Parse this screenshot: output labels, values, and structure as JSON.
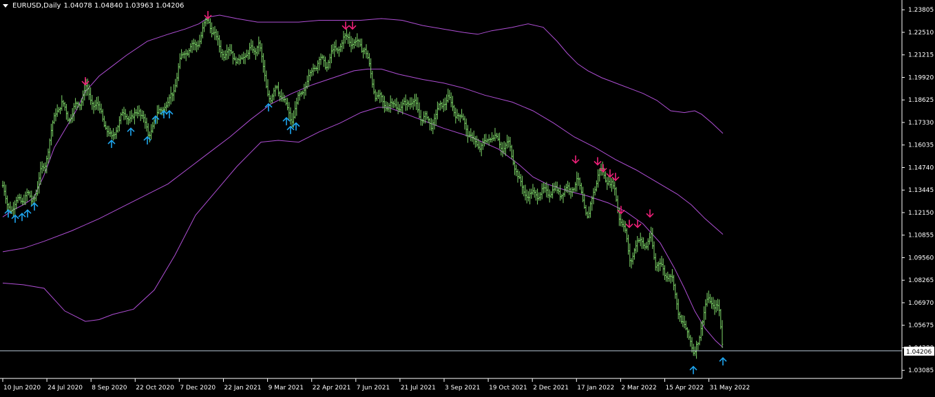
{
  "header": {
    "symbol_timeframe": "EURUSD,Daily",
    "ohlc": "1.04078 1.04840 1.03963 1.04206"
  },
  "colors": {
    "background": "#000000",
    "bars": "#7fd96a",
    "bands": "#b04fd6",
    "up_arrow": "#1ea6f0",
    "down_arrow": "#f0207a",
    "axis": "#ffffff",
    "price_line": "#b8c8d8"
  },
  "chart_data": {
    "type": "bar",
    "title": "EURUSD,Daily",
    "ylim": [
      1.0262,
      1.2421
    ],
    "y_ticks": [
      "1.23805",
      "1.22510",
      "1.21215",
      "1.19920",
      "1.18625",
      "1.17330",
      "1.16035",
      "1.14740",
      "1.13445",
      "1.12150",
      "1.10855",
      "1.09560",
      "1.08265",
      "1.06970",
      "1.05675",
      "1.04380",
      "1.03085"
    ],
    "current_price_label": "1.04206",
    "current_price": 1.04206,
    "x_tick_labels": [
      "10 Jun 2020",
      "24 Jul 2020",
      "8 Sep 2020",
      "22 Oct 2020",
      "7 Dec 2020",
      "22 Jan 2021",
      "9 Mar 2021",
      "22 Apr 2021",
      "7 Jun 2021",
      "21 Jul 2021",
      "3 Sep 2021",
      "19 Oct 2021",
      "2 Dec 2021",
      "17 Jan 2022",
      "2 Mar 2022",
      "15 Apr 2022",
      "31 May 2022"
    ],
    "price_path": [
      [
        0,
        1.137
      ],
      [
        6,
        1.124
      ],
      [
        12,
        1.123
      ],
      [
        20,
        1.126
      ],
      [
        28,
        1.129
      ],
      [
        35,
        1.133
      ],
      [
        42,
        1.129
      ],
      [
        50,
        1.137
      ],
      [
        55,
        1.144
      ],
      [
        62,
        1.15
      ],
      [
        70,
        1.165
      ],
      [
        78,
        1.18
      ],
      [
        86,
        1.184
      ],
      [
        95,
        1.177
      ],
      [
        103,
        1.182
      ],
      [
        112,
        1.185
      ],
      [
        120,
        1.193
      ],
      [
        128,
        1.184
      ],
      [
        136,
        1.183
      ],
      [
        144,
        1.177
      ],
      [
        152,
        1.17
      ],
      [
        158,
        1.164
      ],
      [
        166,
        1.173
      ],
      [
        174,
        1.177
      ],
      [
        182,
        1.176
      ],
      [
        190,
        1.174
      ],
      [
        198,
        1.181
      ],
      [
        205,
        1.176
      ],
      [
        211,
        1.166
      ],
      [
        218,
        1.174
      ],
      [
        225,
        1.178
      ],
      [
        232,
        1.182
      ],
      [
        240,
        1.183
      ],
      [
        248,
        1.19
      ],
      [
        256,
        1.206
      ],
      [
        264,
        1.215
      ],
      [
        272,
        1.218
      ],
      [
        280,
        1.218
      ],
      [
        288,
        1.223
      ],
      [
        298,
        1.232
      ],
      [
        306,
        1.223
      ],
      [
        314,
        1.218
      ],
      [
        322,
        1.213
      ],
      [
        332,
        1.216
      ],
      [
        342,
        1.207
      ],
      [
        350,
        1.211
      ],
      [
        358,
        1.213
      ],
      [
        366,
        1.213
      ],
      [
        372,
        1.221
      ],
      [
        378,
        1.205
      ],
      [
        384,
        1.193
      ],
      [
        390,
        1.188
      ],
      [
        398,
        1.194
      ],
      [
        406,
        1.187
      ],
      [
        414,
        1.178
      ],
      [
        420,
        1.174
      ],
      [
        428,
        1.185
      ],
      [
        436,
        1.193
      ],
      [
        444,
        1.2
      ],
      [
        452,
        1.206
      ],
      [
        460,
        1.209
      ],
      [
        470,
        1.205
      ],
      [
        478,
        1.212
      ],
      [
        486,
        1.216
      ],
      [
        494,
        1.221
      ],
      [
        502,
        1.224
      ],
      [
        510,
        1.219
      ],
      [
        518,
        1.218
      ],
      [
        526,
        1.214
      ],
      [
        534,
        1.201
      ],
      [
        542,
        1.188
      ],
      [
        550,
        1.187
      ],
      [
        560,
        1.184
      ],
      [
        570,
        1.184
      ],
      [
        580,
        1.18
      ],
      [
        590,
        1.185
      ],
      [
        598,
        1.184
      ],
      [
        606,
        1.178
      ],
      [
        614,
        1.177
      ],
      [
        622,
        1.173
      ],
      [
        630,
        1.178
      ],
      [
        638,
        1.183
      ],
      [
        646,
        1.186
      ],
      [
        654,
        1.181
      ],
      [
        662,
        1.178
      ],
      [
        670,
        1.175
      ],
      [
        678,
        1.167
      ],
      [
        686,
        1.161
      ],
      [
        694,
        1.159
      ],
      [
        702,
        1.16
      ],
      [
        710,
        1.166
      ],
      [
        718,
        1.164
      ],
      [
        726,
        1.16
      ],
      [
        734,
        1.162
      ],
      [
        742,
        1.152
      ],
      [
        750,
        1.138
      ],
      [
        758,
        1.132
      ],
      [
        766,
        1.13
      ],
      [
        774,
        1.133
      ],
      [
        782,
        1.134
      ],
      [
        790,
        1.135
      ],
      [
        800,
        1.134
      ],
      [
        810,
        1.132
      ],
      [
        818,
        1.133
      ],
      [
        826,
        1.135
      ],
      [
        834,
        1.141
      ],
      [
        842,
        1.132
      ],
      [
        850,
        1.118
      ],
      [
        858,
        1.133
      ],
      [
        866,
        1.145
      ],
      [
        874,
        1.14
      ],
      [
        880,
        1.14
      ],
      [
        888,
        1.135
      ],
      [
        895,
        1.122
      ],
      [
        903,
        1.113
      ],
      [
        911,
        1.095
      ],
      [
        919,
        1.1
      ],
      [
        927,
        1.106
      ],
      [
        935,
        1.1
      ],
      [
        942,
        1.108
      ],
      [
        948,
        1.093
      ],
      [
        956,
        1.092
      ],
      [
        962,
        1.088
      ],
      [
        968,
        1.086
      ],
      [
        974,
        1.08
      ],
      [
        980,
        1.067
      ],
      [
        986,
        1.056
      ],
      [
        992,
        1.053
      ],
      [
        998,
        1.051
      ],
      [
        1004,
        1.039
      ],
      [
        1010,
        1.048
      ],
      [
        1016,
        1.062
      ],
      [
        1022,
        1.07
      ],
      [
        1028,
        1.071
      ],
      [
        1034,
        1.068
      ],
      [
        1040,
        1.064
      ],
      [
        1046,
        1.042
      ]
    ],
    "series": [
      {
        "name": "",
        "kind": "upper_band",
        "points": [
          [
            0,
            1.119
          ],
          [
            15,
            1.123
          ],
          [
            30,
            1.126
          ],
          [
            45,
            1.13
          ],
          [
            60,
            1.143
          ],
          [
            75,
            1.159
          ],
          [
            90,
            1.169
          ],
          [
            105,
            1.179
          ],
          [
            120,
            1.191
          ],
          [
            140,
            1.2
          ],
          [
            160,
            1.206
          ],
          [
            180,
            1.212
          ],
          [
            210,
            1.22
          ],
          [
            240,
            1.224
          ],
          [
            265,
            1.227
          ],
          [
            285,
            1.23
          ],
          [
            300,
            1.234
          ],
          [
            315,
            1.235
          ],
          [
            340,
            1.233
          ],
          [
            370,
            1.231
          ],
          [
            400,
            1.231
          ],
          [
            430,
            1.231
          ],
          [
            460,
            1.232
          ],
          [
            490,
            1.232
          ],
          [
            520,
            1.232
          ],
          [
            550,
            1.233
          ],
          [
            580,
            1.232
          ],
          [
            610,
            1.229
          ],
          [
            640,
            1.227
          ],
          [
            670,
            1.225
          ],
          [
            690,
            1.224
          ],
          [
            710,
            1.226
          ],
          [
            740,
            1.228
          ],
          [
            763,
            1.23
          ],
          [
            785,
            1.228
          ],
          [
            805,
            1.22
          ],
          [
            820,
            1.213
          ],
          [
            835,
            1.207
          ],
          [
            850,
            1.203
          ],
          [
            870,
            1.199
          ],
          [
            890,
            1.196
          ],
          [
            910,
            1.193
          ],
          [
            930,
            1.19
          ],
          [
            950,
            1.186
          ],
          [
            970,
            1.18
          ],
          [
            990,
            1.179
          ],
          [
            1005,
            1.18
          ],
          [
            1015,
            1.178
          ],
          [
            1030,
            1.173
          ],
          [
            1046,
            1.167
          ]
        ]
      },
      {
        "name": "",
        "kind": "middle_band",
        "points": [
          [
            0,
            1.099
          ],
          [
            30,
            1.101
          ],
          [
            60,
            1.105
          ],
          [
            100,
            1.111
          ],
          [
            140,
            1.118
          ],
          [
            180,
            1.126
          ],
          [
            210,
            1.132
          ],
          [
            240,
            1.138
          ],
          [
            270,
            1.147
          ],
          [
            300,
            1.156
          ],
          [
            330,
            1.165
          ],
          [
            360,
            1.175
          ],
          [
            390,
            1.184
          ],
          [
            420,
            1.19
          ],
          [
            450,
            1.195
          ],
          [
            480,
            1.199
          ],
          [
            510,
            1.203
          ],
          [
            530,
            1.204
          ],
          [
            550,
            1.204
          ],
          [
            575,
            1.201
          ],
          [
            610,
            1.198
          ],
          [
            640,
            1.196
          ],
          [
            670,
            1.193
          ],
          [
            700,
            1.189
          ],
          [
            740,
            1.185
          ],
          [
            770,
            1.18
          ],
          [
            800,
            1.173
          ],
          [
            830,
            1.165
          ],
          [
            860,
            1.159
          ],
          [
            890,
            1.152
          ],
          [
            920,
            1.146
          ],
          [
            950,
            1.139
          ],
          [
            980,
            1.132
          ],
          [
            1000,
            1.126
          ],
          [
            1020,
            1.118
          ],
          [
            1046,
            1.109
          ]
        ]
      },
      {
        "name": "",
        "kind": "lower_band",
        "points": [
          [
            0,
            1.081
          ],
          [
            30,
            1.08
          ],
          [
            60,
            1.078
          ],
          [
            90,
            1.065
          ],
          [
            120,
            1.059
          ],
          [
            140,
            1.06
          ],
          [
            160,
            1.063
          ],
          [
            190,
            1.066
          ],
          [
            220,
            1.077
          ],
          [
            250,
            1.097
          ],
          [
            280,
            1.12
          ],
          [
            310,
            1.134
          ],
          [
            340,
            1.148
          ],
          [
            360,
            1.156
          ],
          [
            375,
            1.162
          ],
          [
            400,
            1.163
          ],
          [
            430,
            1.162
          ],
          [
            460,
            1.168
          ],
          [
            490,
            1.173
          ],
          [
            520,
            1.179
          ],
          [
            545,
            1.182
          ],
          [
            560,
            1.182
          ],
          [
            600,
            1.176
          ],
          [
            640,
            1.17
          ],
          [
            680,
            1.165
          ],
          [
            720,
            1.158
          ],
          [
            750,
            1.149
          ],
          [
            770,
            1.142
          ],
          [
            790,
            1.138
          ],
          [
            820,
            1.134
          ],
          [
            850,
            1.131
          ],
          [
            880,
            1.127
          ],
          [
            905,
            1.122
          ],
          [
            930,
            1.115
          ],
          [
            955,
            1.104
          ],
          [
            975,
            1.09
          ],
          [
            990,
            1.078
          ],
          [
            1005,
            1.065
          ],
          [
            1020,
            1.055
          ],
          [
            1035,
            1.048
          ],
          [
            1046,
            1.044
          ]
        ]
      }
    ],
    "up_arrows": [
      [
        8,
        1.123
      ],
      [
        18,
        1.12
      ],
      [
        28,
        1.121
      ],
      [
        36,
        1.123
      ],
      [
        46,
        1.127
      ],
      [
        158,
        1.163
      ],
      [
        186,
        1.17
      ],
      [
        210,
        1.165
      ],
      [
        222,
        1.177
      ],
      [
        234,
        1.18
      ],
      [
        242,
        1.18
      ],
      [
        386,
        1.184
      ],
      [
        412,
        1.176
      ],
      [
        418,
        1.171
      ],
      [
        426,
        1.173
      ],
      [
        1003,
        1.033
      ],
      [
        1046,
        1.038
      ]
    ],
    "down_arrows": [
      [
        120,
        1.195
      ],
      [
        298,
        1.233
      ],
      [
        498,
        1.227
      ],
      [
        508,
        1.227
      ],
      [
        832,
        1.15
      ],
      [
        864,
        1.149
      ],
      [
        872,
        1.145
      ],
      [
        882,
        1.142
      ],
      [
        890,
        1.14
      ],
      [
        898,
        1.121
      ],
      [
        910,
        1.113
      ],
      [
        922,
        1.113
      ],
      [
        940,
        1.119
      ]
    ]
  }
}
